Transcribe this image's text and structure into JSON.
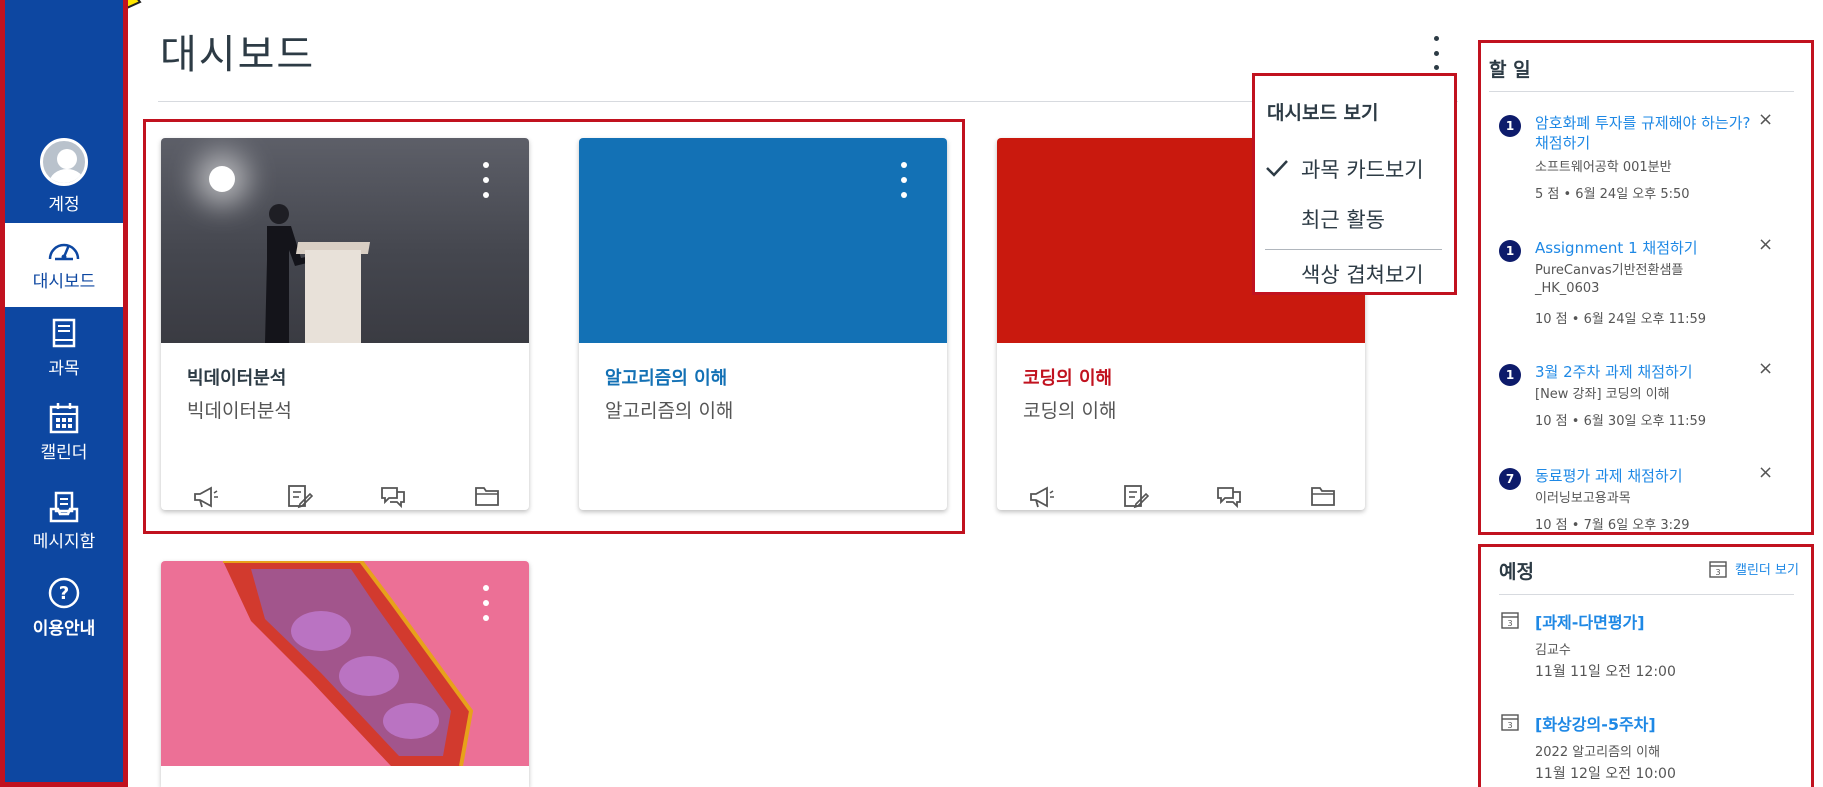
{
  "nav": {
    "items": [
      {
        "label": "계정",
        "icon": "user-avatar-icon"
      },
      {
        "label": "대시보드",
        "icon": "dashboard-gauge-icon",
        "active": true
      },
      {
        "label": "과목",
        "icon": "book-icon"
      },
      {
        "label": "캘린더",
        "icon": "calendar-icon"
      },
      {
        "label": "메시지함",
        "icon": "inbox-icon"
      },
      {
        "label": "이용안내",
        "icon": "help-circle-icon"
      }
    ]
  },
  "header": {
    "title": "대시보드"
  },
  "view_menu": {
    "heading": "대시보드 보기",
    "options": [
      {
        "label": "과목 카드보기",
        "checked": true
      },
      {
        "label": "최근 활동",
        "checked": false
      },
      {
        "label": "색상 겹쳐보기",
        "checked": false
      }
    ]
  },
  "cards": [
    {
      "name": "빅데이터분석",
      "subtitle": "빅데이터분석",
      "color": "#2d3b45",
      "hero": "speaker-photo"
    },
    {
      "name": "알고리즘의 이해",
      "subtitle": "알고리즘의 이해",
      "color": "#1371b5",
      "hero": "solid-blue"
    },
    {
      "name": "코딩의 이해",
      "subtitle": "코딩의 이해",
      "color": "#c1121f",
      "hero": "solid-red"
    },
    {
      "name": "",
      "subtitle": "",
      "color": "#ec7096",
      "hero": "pink-3d-model"
    }
  ],
  "todo": {
    "heading": "할 일",
    "items": [
      {
        "count": "1",
        "title": "암호화폐 투자를 규제해야 하는가? 채점하기",
        "course": "소프트웨어공학 001분반",
        "meta": "5 점 • 6월 24일 오후 5:50"
      },
      {
        "count": "1",
        "title": "Assignment 1 채점하기",
        "course": "PureCanvas기반전환샘플_HK_0603",
        "meta": "10 점 • 6월 24일 오후 11:59"
      },
      {
        "count": "1",
        "title": "3월 2주차 과제 채점하기",
        "course": "[New 강좌] 코딩의 이해",
        "meta": "10 점 • 6월 30일 오후 11:59"
      },
      {
        "count": "7",
        "title": "동료평가 과제 채점하기",
        "course": "이러닝보고용과목",
        "meta": "10 점 • 7월 6일 오후 3:29"
      }
    ],
    "dismiss": "×"
  },
  "upcoming": {
    "heading": "예정",
    "calendar_link": "캘린더 보기",
    "events": [
      {
        "title": "[과제-다면평가]",
        "course": "김교수",
        "date": "11월 11일 오전 12:00"
      },
      {
        "title": "[화상강의-5주차]",
        "course": "2022 알고리즘의 이해",
        "date": "11월 12일 오전 10:00"
      }
    ]
  },
  "colors": {
    "nav_bg": "#0d47a1",
    "highlight_border": "#c1121f",
    "link": "#1e88e5",
    "card_blue": "#1371b5",
    "card_red": "#c1121f",
    "card_pink": "#ec7096"
  }
}
